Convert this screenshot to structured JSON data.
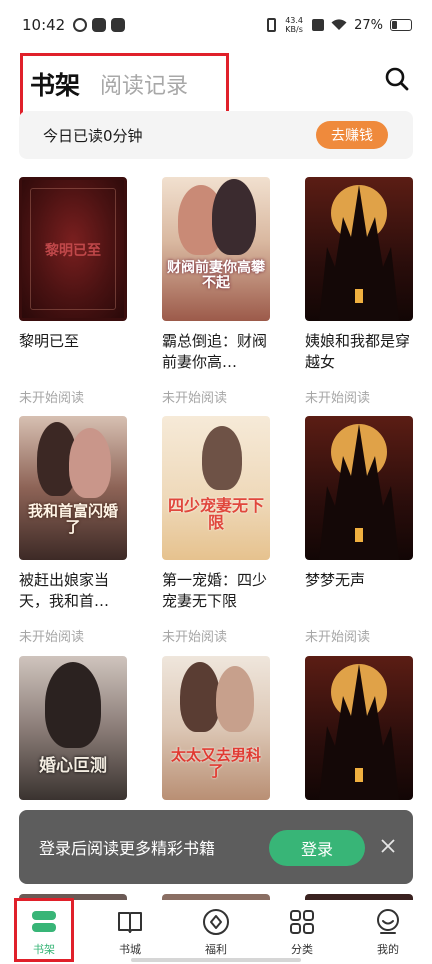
{
  "status_bar": {
    "time": "10:42",
    "net_speed_value": "43.4",
    "net_speed_unit": "KB/s",
    "battery_percent": "27%",
    "battery_level": 0.27
  },
  "header": {
    "tab_bookshelf": "书架",
    "tab_history": "阅读记录",
    "search_icon": "search-icon"
  },
  "reading_bar": {
    "text": "今日已读0分钟",
    "earn_button": "去赚钱"
  },
  "books": [
    {
      "title": "黎明已至",
      "status": "未开始阅读",
      "cover_text": "黎明已至"
    },
    {
      "title": "霸总倒追：财阀前妻你高…",
      "status": "未开始阅读",
      "cover_text": "财阀前妻你高攀不起"
    },
    {
      "title": "姨娘和我都是穿越女",
      "status": "未开始阅读",
      "cover_text": ""
    },
    {
      "title": "被赶出娘家当天，我和首…",
      "status": "未开始阅读",
      "cover_text": "我和首富闪婚了"
    },
    {
      "title": "第一宠婚：四少宠妻无下限",
      "status": "未开始阅读",
      "cover_text": "四少宠妻无下限"
    },
    {
      "title": "梦梦无声",
      "status": "未开始阅读",
      "cover_text": ""
    },
    {
      "title": "",
      "status": "",
      "cover_text": "婚心叵测"
    },
    {
      "title": "",
      "status": "",
      "cover_text": "太太又去男科了"
    },
    {
      "title": "",
      "status": "",
      "cover_text": ""
    }
  ],
  "login_banner": {
    "text": "登录后阅读更多精彩书籍",
    "button": "登录",
    "close_icon": "close-icon"
  },
  "bottom_nav": {
    "items": [
      {
        "label": "书架",
        "icon": "bookshelf-icon",
        "active": true
      },
      {
        "label": "书城",
        "icon": "book-icon",
        "active": false
      },
      {
        "label": "福利",
        "icon": "welfare-icon",
        "active": false
      },
      {
        "label": "分类",
        "icon": "grid-icon",
        "active": false
      },
      {
        "label": "我的",
        "icon": "profile-icon",
        "active": false
      }
    ]
  },
  "colors": {
    "accent_green": "#38b577",
    "earn_orange": "#ef8a3c",
    "highlight_red": "#e0202a"
  }
}
